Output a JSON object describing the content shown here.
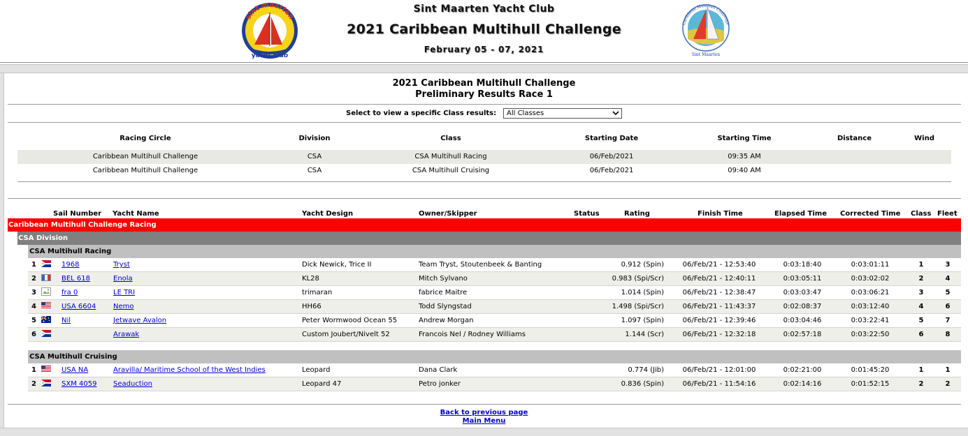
{
  "banner": {
    "club_name": "Sint Maarten Yacht Club",
    "event_title": "2021 Caribbean Multihull Challenge",
    "event_dates": "February 05 - 07, 2021",
    "logo_left_top": "sint maarten",
    "logo_left_bottom": "yacht club",
    "logo_right_top": "Caribbean Multihull Challenge",
    "logo_right_bottom": "Sint Maarten"
  },
  "results": {
    "title": "2021 Caribbean Multihull Challenge",
    "subtitle": "Preliminary Results Race 1"
  },
  "class_filter": {
    "label": "Select to view a specific Class results:",
    "selected": "All Classes"
  },
  "race_info": {
    "headers": [
      "Racing Circle",
      "Division",
      "Class",
      "Starting Date",
      "Starting Time",
      "Distance",
      "Wind"
    ],
    "rows": [
      [
        "Caribbean Multihull Challenge",
        "CSA",
        "CSA Multihull Racing",
        "06/Feb/2021",
        "09:35 AM",
        "",
        ""
      ],
      [
        "Caribbean Multihull Challenge",
        "CSA",
        "CSA Multihull Cruising",
        "06/Feb/2021",
        "09:40 AM",
        "",
        ""
      ]
    ]
  },
  "table": {
    "headers": [
      "Sail Number",
      "Yacht Name",
      "Yacht Design",
      "Owner/Skipper",
      "Status",
      "Rating",
      "Finish Time",
      "Elapsed Time",
      "Corrected Time",
      "Class",
      "Fleet"
    ]
  },
  "fleet": "Caribbean Multihull Challenge Racing",
  "division": "CSA Division",
  "classes": [
    {
      "name": "CSA Multihull Racing",
      "rows": [
        {
          "pos": "1",
          "flag": "sxm",
          "sail": "1968",
          "yacht": "Tryst",
          "design": "Dick Newick, Trice II",
          "owner": "Team Tryst, Stoutenbeek & Banting",
          "status": "",
          "rating": "0.912 (Spin)",
          "finish": "06/Feb/21 - 12:53:40",
          "elapsed": "0:03:18:40",
          "corrected": "0:03:01:11",
          "class": "1",
          "fleet": "3"
        },
        {
          "pos": "2",
          "flag": "bel",
          "sail": "BEL 618",
          "yacht": "Enola",
          "design": "KL28",
          "owner": "Mitch Sylvano",
          "status": "",
          "rating": "0.983 (Spi/Scr)",
          "finish": "06/Feb/21 - 12:40:11",
          "elapsed": "0:03:05:11",
          "corrected": "0:03:02:02",
          "class": "2",
          "fleet": "4"
        },
        {
          "pos": "3",
          "flag": "broken",
          "sail": "fra 0",
          "yacht": "LE TRI",
          "design": "trimaran",
          "owner": "fabrice Maitre",
          "status": "",
          "rating": "1.014 (Spin)",
          "finish": "06/Feb/21 - 12:38:47",
          "elapsed": "0:03:03:47",
          "corrected": "0:03:06:21",
          "class": "3",
          "fleet": "5"
        },
        {
          "pos": "4",
          "flag": "usa",
          "sail": "USA 6604",
          "yacht": "Nemo",
          "design": "HH66",
          "owner": "Todd Slyngstad",
          "status": "",
          "rating": "1.498 (Spi/Scr)",
          "finish": "06/Feb/21 - 11:43:37",
          "elapsed": "0:02:08:37",
          "corrected": "0:03:12:40",
          "class": "4",
          "fleet": "6"
        },
        {
          "pos": "5",
          "flag": "aus",
          "sail": "Nil",
          "yacht": "Jetwave Avalon",
          "design": "Peter Wormwood Ocean 55",
          "owner": "Andrew Morgan",
          "status": "",
          "rating": "1.097 (Spin)",
          "finish": "06/Feb/21 - 12:39:46",
          "elapsed": "0:03:04:46",
          "corrected": "0:03:22:41",
          "class": "5",
          "fleet": "7"
        },
        {
          "pos": "6",
          "flag": "sxm",
          "sail": "",
          "yacht": "Arawak",
          "design": "Custom Joubert/Nivelt 52",
          "owner": "Francois Nel / Rodney Williams",
          "status": "",
          "rating": "1.144 (Scr)",
          "finish": "06/Feb/21 - 12:32:18",
          "elapsed": "0:02:57:18",
          "corrected": "0:03:22:50",
          "class": "6",
          "fleet": "8"
        }
      ]
    },
    {
      "name": "CSA Multihull Cruising",
      "rows": [
        {
          "pos": "1",
          "flag": "usa",
          "sail": "USA NA",
          "yacht": "Aravilla/ Maritime School of the West Indies",
          "design": "Leopard",
          "owner": "Dana Clark",
          "status": "",
          "rating": "0.774 (Jib)",
          "finish": "06/Feb/21 - 12:01:00",
          "elapsed": "0:02:21:00",
          "corrected": "0:01:45:20",
          "class": "1",
          "fleet": "1"
        },
        {
          "pos": "2",
          "flag": "sxm",
          "sail": "SXM 4059",
          "yacht": "Seaduction",
          "design": "Leopard 47",
          "owner": "Petro jonker",
          "status": "",
          "rating": "0.836 (Spin)",
          "finish": "06/Feb/21 - 11:54:16",
          "elapsed": "0:02:14:16",
          "corrected": "0:01:52:15",
          "class": "2",
          "fleet": "2"
        }
      ]
    }
  ],
  "footer": {
    "back_link": "Back to previous page",
    "main_menu": "Main Menu"
  },
  "colors": {
    "fleet_bar": "#ff0000",
    "division_bar": "#808080",
    "class_bar": "#c0c0c0",
    "link": "#0000cc"
  }
}
